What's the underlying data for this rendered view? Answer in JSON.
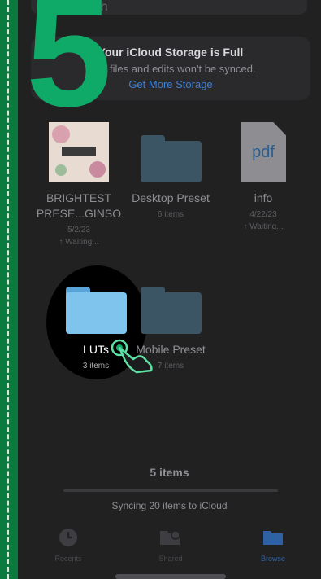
{
  "search": {
    "placeholder": "Search"
  },
  "storage_banner": {
    "title": "Your iCloud Storage is Full",
    "subtitle": "New files and edits won't be synced.",
    "link": "Get More Storage"
  },
  "overlay": {
    "step_number": "5"
  },
  "files": [
    {
      "name_line1": "BRIGHTEST",
      "name_line2": "PRESE...GINSO",
      "date": "5/2/23",
      "status": "↑ Waiting..."
    },
    {
      "name": "Desktop Preset",
      "meta": "6 items"
    },
    {
      "name": "info",
      "icon_text": "pdf",
      "date": "4/22/23",
      "status": "↑ Waiting..."
    },
    {
      "name": "LUTs",
      "meta": "3 items"
    },
    {
      "name": "Mobile Preset",
      "meta": "7 items"
    }
  ],
  "footer": {
    "count": "5 items",
    "sync_text": "Syncing 20 items to iCloud",
    "progress": 0
  },
  "tabs": [
    {
      "label": "Recents",
      "icon": "clock-icon"
    },
    {
      "label": "Shared",
      "icon": "shared-folder-icon"
    },
    {
      "label": "Browse",
      "icon": "folder-icon",
      "active": true
    }
  ],
  "colors": {
    "accent": "#3f7fd0",
    "overlay_green": "#0fa968",
    "strip_green": "#0a7a3e"
  }
}
